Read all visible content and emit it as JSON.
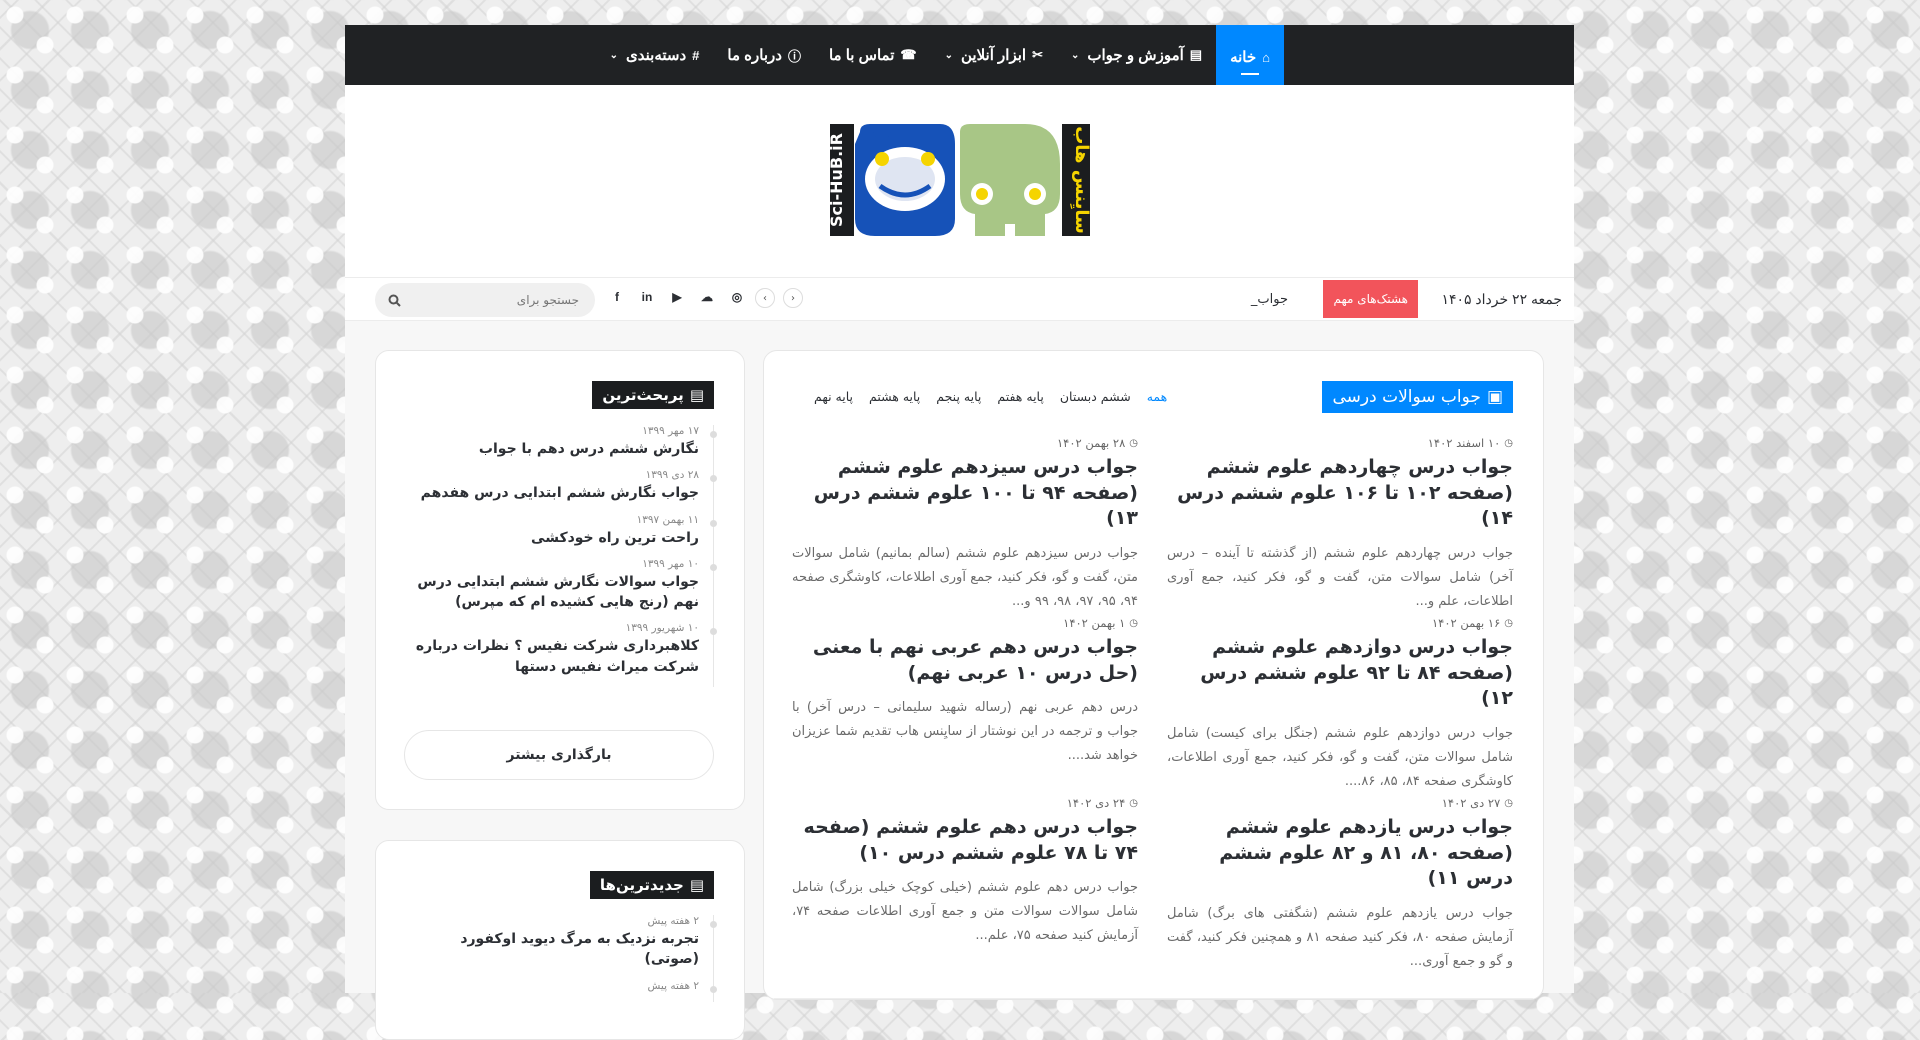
{
  "nav": {
    "items": [
      {
        "label": "خانه",
        "icon": "home-icon",
        "glyph": "⌂",
        "active": true,
        "dropdown": false
      },
      {
        "label": "آموزش و جواب",
        "icon": "book-icon",
        "glyph": "▤",
        "active": false,
        "dropdown": true
      },
      {
        "label": "ابزار آنلاین",
        "icon": "tools-icon",
        "glyph": "✂",
        "active": false,
        "dropdown": true
      },
      {
        "label": "تماس با ما",
        "icon": "fax-icon",
        "glyph": "☎",
        "active": false,
        "dropdown": false
      },
      {
        "label": "درباره ما",
        "icon": "info-icon",
        "glyph": "ⓘ",
        "active": false,
        "dropdown": false
      },
      {
        "label": "دسته‌بندی",
        "icon": "hashtag-icon",
        "glyph": "#",
        "active": false,
        "dropdown": true
      }
    ],
    "accent": "#0088ff"
  },
  "header": {
    "logo_left_text": "Sci-HuB.iR",
    "logo_right_text": "سایِنس هاب"
  },
  "topbar": {
    "date": "جمعه ۲۲ خرداد ۱۴۰۵",
    "badge": "هشتک‌های مهم",
    "badge_color": "#f2545b",
    "ticker": "جواب_",
    "search_placeholder": "جستجو برای"
  },
  "social": [
    {
      "name": "facebook-icon",
      "glyph": "f"
    },
    {
      "name": "linkedin-icon",
      "glyph": "in"
    },
    {
      "name": "youtube-icon",
      "glyph": "▶"
    },
    {
      "name": "soundcloud-icon",
      "glyph": "☁"
    },
    {
      "name": "instagram-icon",
      "glyph": "◎"
    }
  ],
  "main": {
    "section_title": "جواب سوالات درسی",
    "tabs": [
      "همه",
      "ششم دبستان",
      "پایه هفتم",
      "پایه پنجم",
      "پایه هشتم",
      "پایه نهم"
    ],
    "posts": [
      {
        "date": "۱۰ اسفند ۱۴۰۲",
        "title": "جواب درس چهاردهم علوم ششم (صفحه ۱۰۲ تا ۱۰۶ علوم ششم درس ۱۴)",
        "excerpt": "جواب درس چهاردهم علوم ششم (از گذشته تا آینده – درس آخر) شامل سوالات متن، گفت و گو، فکر کنید، جمع آوری اطلاعات، علم و..."
      },
      {
        "date": "۲۸ بهمن ۱۴۰۲",
        "title": "جواب درس سیزدهم علوم ششم (صفحه ۹۴ تا ۱۰۰ علوم ششم درس ۱۳)",
        "excerpt": "جواب درس سیزدهم علوم ششم (سالم بمانیم) شامل سوالات متن، گفت و گو، فکر کنید، جمع آوری اطلاعات، کاوشگری صفحه ۹۴، ۹۵، ۹۷، ۹۸، ۹۹ و..."
      },
      {
        "date": "۱۶ بهمن ۱۴۰۲",
        "title": "جواب درس دوازدهم علوم ششم (صفحه ۸۴ تا ۹۲ علوم ششم درس ۱۲)",
        "excerpt": "جواب درس دوازدهم علوم ششم (جنگل برای کیست) شامل شامل سوالات متن، گفت و گو، فکر کنید، جمع آوری اطلاعات، کاوشگری صفحه ۸۴، ۸۵، ۸۶...."
      },
      {
        "date": "۱ بهمن ۱۴۰۲",
        "title": "جواب درس دهم عربی نهم با معنی (حل درس ۱۰ عربی نهم)",
        "excerpt": "درس دهم عربی نهم (رساله شهید سلیمانی – درس آخر) با جواب و ترجمه در این نوشتار از سایِنس هاب تقدیم شما عزیزان خواهد شد...."
      },
      {
        "date": "۲۷ دی ۱۴۰۲",
        "title": "جواب درس یازدهم علوم ششم (صفحه ۸۰، ۸۱ و ۸۲ علوم ششم درس ۱۱)",
        "excerpt": "جواب درس یازدهم علوم ششم (شگفتی های برگ) شامل آزمایش صفحه ۸۰، فکر کنید صفحه ۸۱ و همچنین فکر کنید، گفت و گو و جمع آوری..."
      },
      {
        "date": "۲۴ دی ۱۴۰۲",
        "title": "جواب درس دهم علوم ششم (صفحه ۷۴ تا ۷۸ علوم ششم درس ۱۰)",
        "excerpt": "جواب درس دهم علوم ششم (خیلی کوچک خیلی بزرگ) شامل شامل سوالات سوالات متن و جمع آوری اطلاعات صفحه ۷۴، آزمایش کنید صفحه ۷۵، علم..."
      }
    ]
  },
  "popular": {
    "title": "پربحث‌ترین",
    "items": [
      {
        "date": "۱۷ مهر ۱۳۹۹",
        "title": "نگارش ششم درس دهم با جواب"
      },
      {
        "date": "۲۸ دی ۱۳۹۹",
        "title": "جواب نگارش ششم ابتدایی درس هفدهم"
      },
      {
        "date": "۱۱ بهمن ۱۳۹۷",
        "title": "راحت ترین راه خودکشی"
      },
      {
        "date": "۱۰ مهر ۱۳۹۹",
        "title": "جواب سوالات نگارش ششم ابتدایی درس نهم (رنج هایی کشیده ام که مپرس)"
      },
      {
        "date": "۱۰ شهریور ۱۳۹۹",
        "title": "کلاهبرداری شرکت نفیس ؟ نظرات درباره شرکت میراث نفیس دستها"
      }
    ],
    "load_more": "بارگذاری بیشتر"
  },
  "latest": {
    "title": "جدیدترین‌ها",
    "items": [
      {
        "date": "۲ هفته پیش",
        "title": "تجربه نزدیک به مرگ دیوید اوکفورد (صوتی)"
      },
      {
        "date": "۲ هفته پیش",
        "title": ""
      }
    ]
  }
}
